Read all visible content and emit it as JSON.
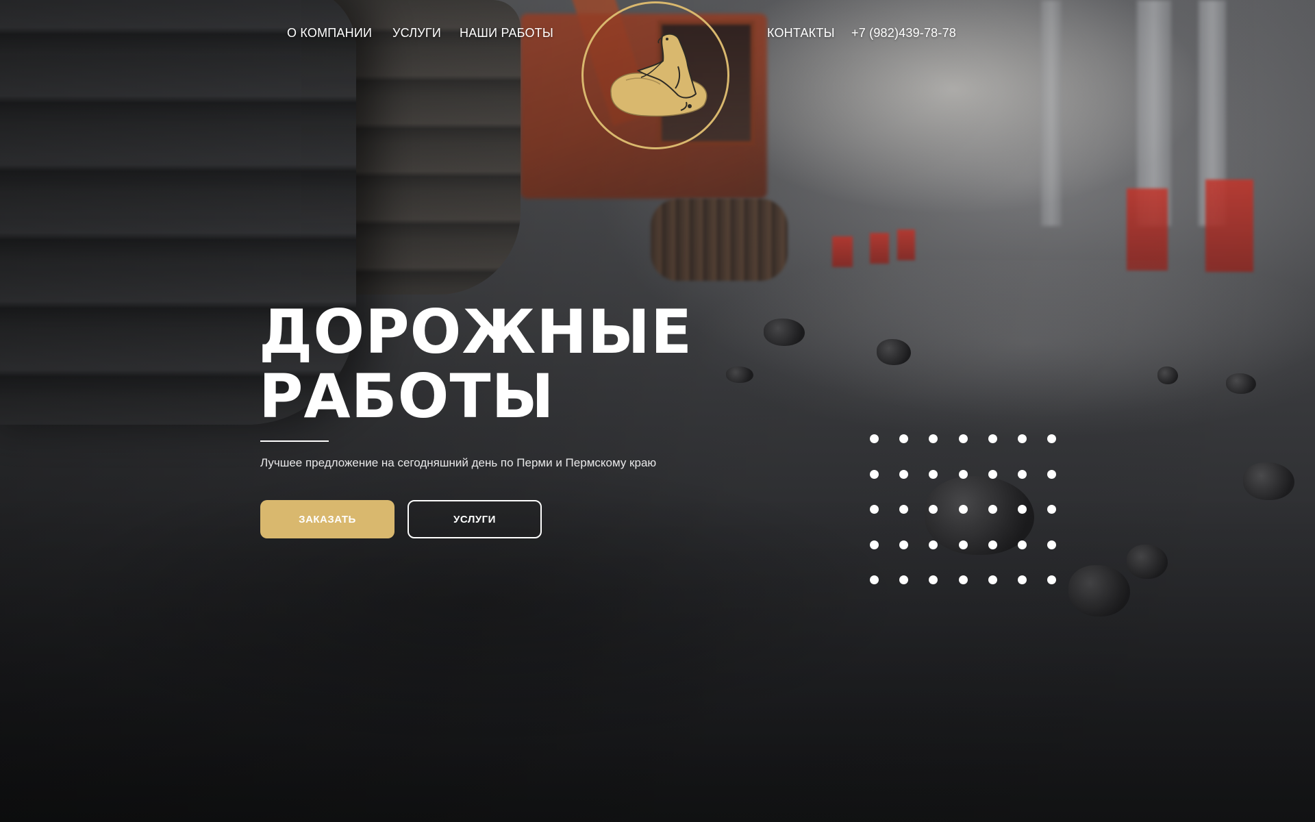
{
  "nav": {
    "left_items": [
      {
        "label": "О КОМПАНИИ"
      },
      {
        "label": "УСЛУГИ"
      },
      {
        "label": "НАШИ РАБОТЫ"
      }
    ],
    "right_items": [
      {
        "label": "КОНТАКТЫ"
      },
      {
        "label": "+7 (982)439-78-78"
      }
    ]
  },
  "logo": {
    "icon": "seal-on-rock-icon",
    "color": "#d9b86e"
  },
  "hero": {
    "title_line1": "ДОРОЖНЫЕ",
    "title_line2": "РАБОТЫ",
    "subtitle": "Лучшее предложение на сегодняшний день по Перми и Пермскому краю",
    "primary_button": "ЗАКАЗАТЬ",
    "secondary_button": "УСЛУГИ"
  },
  "decor": {
    "dot_grid_rows": 5,
    "dot_grid_cols": 7
  },
  "colors": {
    "accent": "#d9b86e",
    "text": "#ffffff"
  }
}
